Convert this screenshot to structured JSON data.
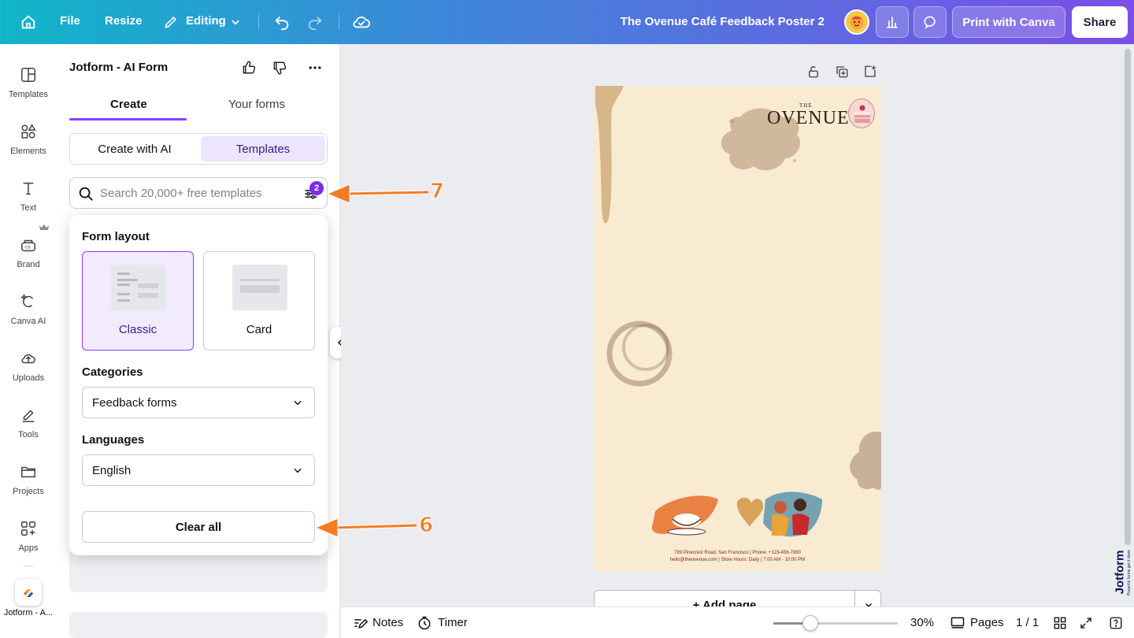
{
  "topbar": {
    "file_label": "File",
    "resize_label": "Resize",
    "editing_label": "Editing",
    "doc_title": "The Ovenue Café Feedback Poster 2",
    "print_label": "Print with Canva",
    "share_label": "Share",
    "gradient_start": "#10b5c8",
    "gradient_end": "#7a4fe6"
  },
  "rail": {
    "items": [
      {
        "label": "Templates",
        "icon": "templates-icon"
      },
      {
        "label": "Elements",
        "icon": "elements-icon"
      },
      {
        "label": "Text",
        "icon": "text-icon"
      },
      {
        "label": "Brand",
        "icon": "brand-icon"
      },
      {
        "label": "Canva AI",
        "icon": "canva-ai-icon"
      },
      {
        "label": "Uploads",
        "icon": "uploads-icon"
      },
      {
        "label": "Tools",
        "icon": "tools-icon"
      },
      {
        "label": "Projects",
        "icon": "projects-icon"
      },
      {
        "label": "Apps",
        "icon": "apps-icon"
      }
    ],
    "active_app_label": "Jotform - A..."
  },
  "panel": {
    "title": "Jotform - AI Form",
    "tabs": [
      "Create",
      "Your forms"
    ],
    "active_tab": "Create",
    "segments": [
      "Create with AI",
      "Templates"
    ],
    "active_segment": "Templates",
    "search_placeholder": "Search 20,000+ free templates",
    "filter_count": "2",
    "accent": "#8b3dff"
  },
  "filters": {
    "layout_heading": "Form layout",
    "layouts": [
      {
        "label": "Classic",
        "selected": true
      },
      {
        "label": "Card",
        "selected": false
      }
    ],
    "categories_heading": "Categories",
    "category_value": "Feedback forms",
    "languages_heading": "Languages",
    "language_value": "English",
    "clear_label": "Clear all"
  },
  "poster": {
    "brand_small": "THE",
    "brand_name": "OVENUE",
    "address_line1": "789 Pinecrest Road, San Francisco | Phone: +123-456-7890",
    "address_line2": "hello@theovenue.com | Store Hours: Daily | 7:00 AM - 10:00 PM",
    "background": "#f8ebd2"
  },
  "canvas": {
    "add_page_label": "+ Add page"
  },
  "bottombar": {
    "notes_label": "Notes",
    "timer_label": "Timer",
    "zoom_label": "30%",
    "zoom_level": 0.3,
    "pages_label": "Pages",
    "page_counter": "1 / 1"
  },
  "annotations": {
    "arrow_search": "7",
    "arrow_clear": "6",
    "color": "#f47b20"
  },
  "watermark": {
    "brand": "Jotform",
    "tagline": "Powerful forms get it done"
  }
}
